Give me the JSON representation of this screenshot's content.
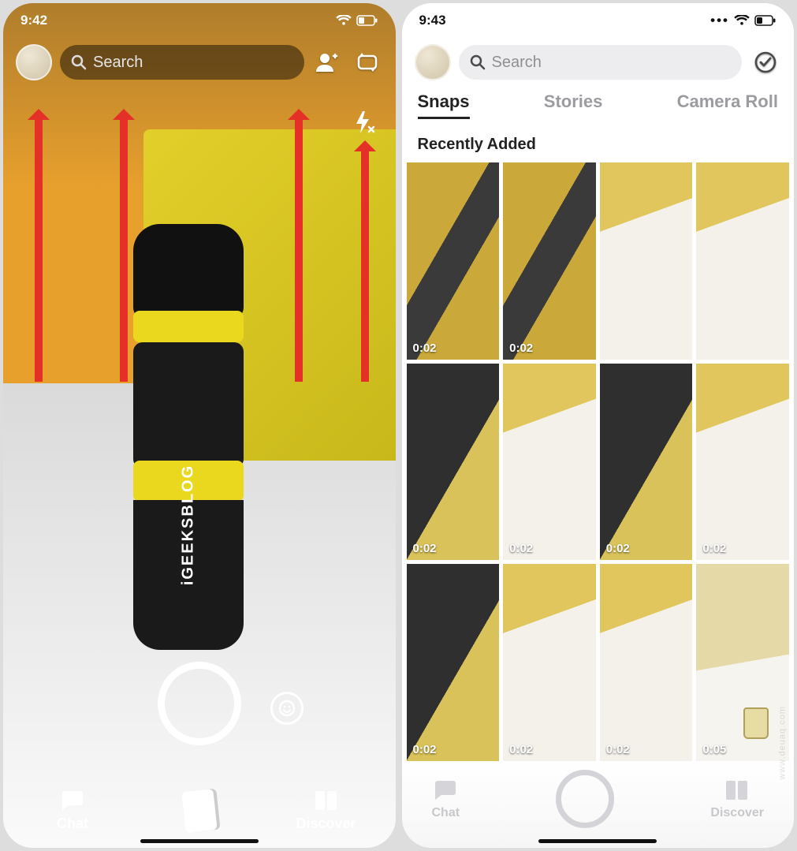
{
  "left": {
    "status_time": "9:42",
    "search_placeholder": "Search",
    "bottle_label": "iGEEKSBLOG",
    "nav": {
      "chat": "Chat",
      "discover": "Discover"
    }
  },
  "right": {
    "status_time": "9:43",
    "search_placeholder": "Search",
    "tabs": {
      "snaps": "Snaps",
      "stories": "Stories",
      "camera_roll": "Camera Roll"
    },
    "section": "Recently Added",
    "tiles": [
      {
        "dur": "0:02",
        "v": "t-portrait"
      },
      {
        "dur": "0:02",
        "v": "t-portrait"
      },
      {
        "dur": "",
        "v": "t-desk"
      },
      {
        "dur": "",
        "v": "t-desk"
      },
      {
        "dur": "0:02",
        "v": "t-dark"
      },
      {
        "dur": "0:02",
        "v": "t-desk"
      },
      {
        "dur": "0:02",
        "v": "t-dark"
      },
      {
        "dur": "0:02",
        "v": "t-desk"
      },
      {
        "dur": "0:02",
        "v": "t-dark"
      },
      {
        "dur": "0:02",
        "v": "t-desk"
      },
      {
        "dur": "0:02",
        "v": "t-desk"
      },
      {
        "dur": "0:05",
        "v": "t-cup"
      }
    ],
    "nav": {
      "chat": "Chat",
      "discover": "Discover"
    }
  },
  "watermark": "www.deuaq.com"
}
